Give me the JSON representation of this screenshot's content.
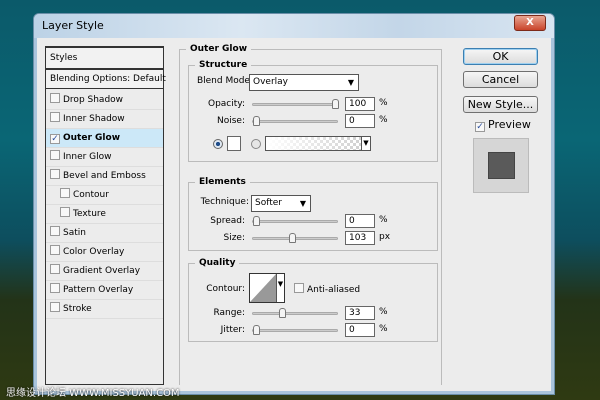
{
  "dialog": {
    "title": "Layer Style",
    "close": "X"
  },
  "styles_list": {
    "header": "Styles",
    "blending": "Blending Options: Default",
    "items": [
      {
        "label": "Drop Shadow",
        "checked": false,
        "indent": false
      },
      {
        "label": "Inner Shadow",
        "checked": false,
        "indent": false
      },
      {
        "label": "Outer Glow",
        "checked": true,
        "indent": false,
        "selected": true
      },
      {
        "label": "Inner Glow",
        "checked": false,
        "indent": false
      },
      {
        "label": "Bevel and Emboss",
        "checked": false,
        "indent": false
      },
      {
        "label": "Contour",
        "checked": false,
        "indent": true
      },
      {
        "label": "Texture",
        "checked": false,
        "indent": true
      },
      {
        "label": "Satin",
        "checked": false,
        "indent": false
      },
      {
        "label": "Color Overlay",
        "checked": false,
        "indent": false
      },
      {
        "label": "Gradient Overlay",
        "checked": false,
        "indent": false
      },
      {
        "label": "Pattern Overlay",
        "checked": false,
        "indent": false
      },
      {
        "label": "Stroke",
        "checked": false,
        "indent": false
      }
    ]
  },
  "outer_glow": {
    "title": "Outer Glow",
    "structure": {
      "title": "Structure",
      "blend_mode_label": "Blend Mode:",
      "blend_mode": "Overlay",
      "opacity_label": "Opacity:",
      "opacity": "100",
      "opacity_unit": "%",
      "noise_label": "Noise:",
      "noise": "0",
      "noise_unit": "%",
      "glow_color": "#ffffff",
      "use_color": true
    },
    "elements": {
      "title": "Elements",
      "technique_label": "Technique:",
      "technique": "Softer",
      "spread_label": "Spread:",
      "spread": "0",
      "spread_unit": "%",
      "size_label": "Size:",
      "size": "103",
      "size_unit": "px"
    },
    "quality": {
      "title": "Quality",
      "contour_label": "Contour:",
      "anti_aliased_label": "Anti-aliased",
      "anti_aliased": false,
      "range_label": "Range:",
      "range": "33",
      "range_unit": "%",
      "jitter_label": "Jitter:",
      "jitter": "0",
      "jitter_unit": "%"
    }
  },
  "buttons": {
    "ok": "OK",
    "cancel": "Cancel",
    "new_style": "New Style...",
    "preview_label": "Preview",
    "preview_checked": true
  },
  "watermark": "思缘设计论坛 WWW.MISSYUAN.COM"
}
